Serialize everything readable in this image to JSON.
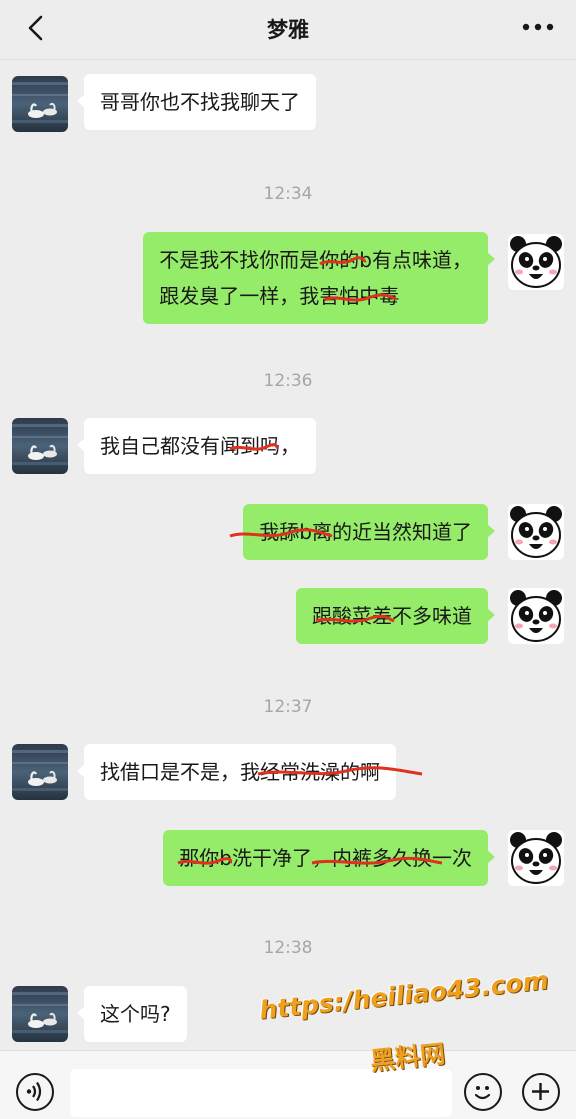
{
  "header": {
    "title": "梦雅",
    "back_icon": "chevron-left-icon",
    "more_icon": "more-dots-icon"
  },
  "messages": [
    {
      "side": "recv",
      "text": "哥哥你也不找我聊天了"
    },
    {
      "timestamp": "12:34"
    },
    {
      "side": "sent",
      "lines": [
        "不是我不找你而是你的b有点味道，",
        "跟发臭了一样，我害怕中毒"
      ]
    },
    {
      "timestamp": "12:36"
    },
    {
      "side": "recv",
      "text": "我自己都没有闻到吗，"
    },
    {
      "side": "sent",
      "text": "我舔b离的近当然知道了"
    },
    {
      "side": "sent",
      "text": "跟酸菜差不多味道"
    },
    {
      "timestamp": "12:37"
    },
    {
      "side": "recv",
      "text": "找借口是不是，我经常洗澡的啊"
    },
    {
      "side": "sent",
      "text": "那你b洗干净了，内裤多久换一次"
    },
    {
      "timestamp": "12:38"
    },
    {
      "side": "recv",
      "text": "这个吗?"
    }
  ],
  "inputbar": {
    "voice_icon": "voice-icon",
    "emoji_icon": "emoji-icon",
    "plus_icon": "plus-icon"
  },
  "watermark": {
    "url": "https:/heiliao43.com",
    "name": "黑料网"
  },
  "colors": {
    "background": "#ededed",
    "sent_bubble": "#95ec69",
    "recv_bubble": "#ffffff",
    "timestamp": "#a6a6a6",
    "scribble": "#e0301e",
    "watermark": "#f0a020"
  }
}
